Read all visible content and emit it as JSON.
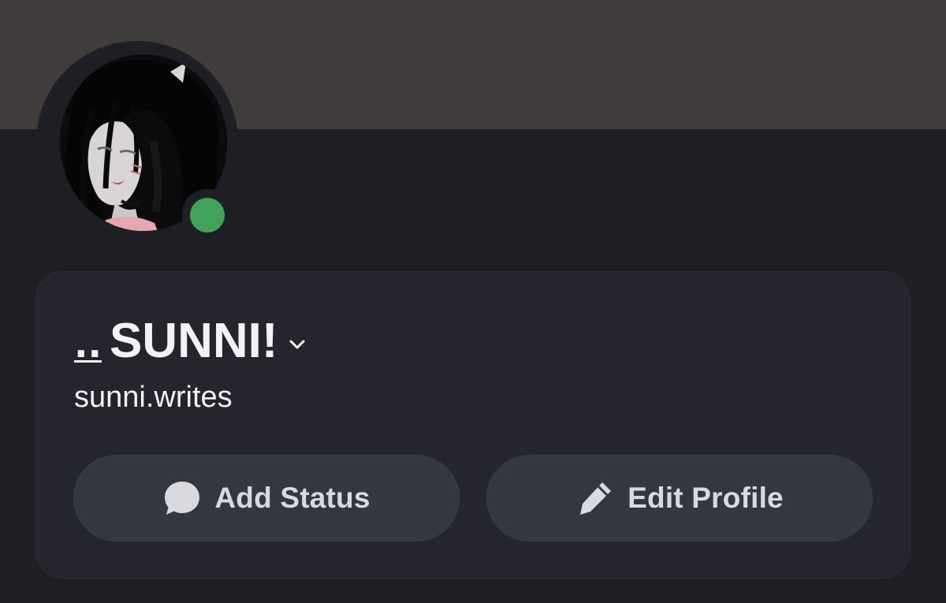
{
  "colors": {
    "banner": "#403c3c",
    "page_background": "#1e1f24",
    "card_background": "#25262d",
    "button_background": "#35373e",
    "text_primary": "#f2f3f5",
    "text_secondary": "#d9dadf",
    "status_online": "#43a25a"
  },
  "profile": {
    "display_name_prefix": "..",
    "display_name": "SUNNI!",
    "username": "sunni.writes",
    "status": "online",
    "avatar_icon": "anime-girl-avatar"
  },
  "actions": {
    "add_status": {
      "label": "Add Status",
      "icon": "speech-bubble-icon"
    },
    "edit_profile": {
      "label": "Edit Profile",
      "icon": "pencil-icon"
    }
  }
}
